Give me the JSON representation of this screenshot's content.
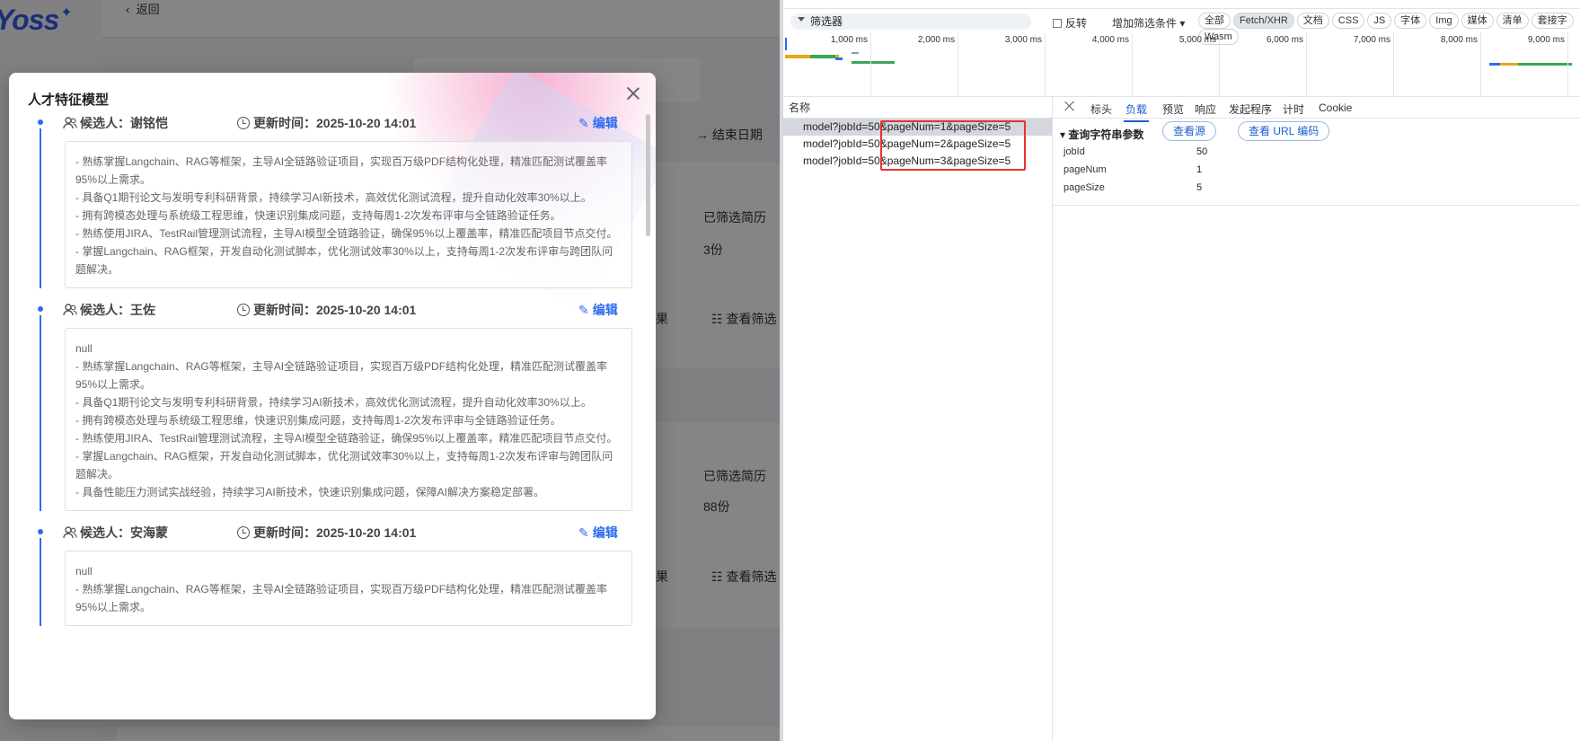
{
  "page": {
    "back_label": "返回",
    "end_date_label": "→ 结束日期",
    "screened_label_1": "已筛选简历",
    "screened_value_1": "3份",
    "screened_label_2": "已筛选简历",
    "screened_value_2": "88份",
    "result_label_1": "果",
    "view_screen_label_1": "查看筛选",
    "result_label_2": "果",
    "view_screen_label_2": "查看筛选"
  },
  "modal": {
    "title": "人才特征模型",
    "candidates": [
      {
        "name_label": "候选人：谢铭恺",
        "time_label": "更新时间：2025-10-20 14:01",
        "edit_label": "编辑",
        "lines": [
          "- 熟练掌握Langchain、RAG等框架，主导AI全链路验证项目，实现百万级PDF结构化处理，精准匹配测试覆盖率95%以上需求。",
          "- 具备Q1期刊论文与发明专利科研背景，持续学习AI新技术，高效优化测试流程，提升自动化效率30%以上。",
          "- 拥有跨模态处理与系统级工程思维，快速识别集成问题，支持每周1-2次发布评审与全链路验证任务。",
          "- 熟练使用JIRA、TestRail管理测试流程，主导AI模型全链路验证，确保95%以上覆盖率，精准匹配项目节点交付。",
          "- 掌握Langchain、RAG框架，开发自动化测试脚本，优化测试效率30%以上，支持每周1-2次发布评审与跨团队问题解决。"
        ]
      },
      {
        "name_label": "候选人：王佐",
        "time_label": "更新时间：2025-10-20 14:01",
        "edit_label": "编辑",
        "lines": [
          "null",
          "- 熟练掌握Langchain、RAG等框架，主导AI全链路验证项目，实现百万级PDF结构化处理，精准匹配测试覆盖率95%以上需求。",
          "- 具备Q1期刊论文与发明专利科研背景，持续学习AI新技术，高效优化测试流程，提升自动化效率30%以上。",
          "- 拥有跨模态处理与系统级工程思维，快速识别集成问题，支持每周1-2次发布评审与全链路验证任务。",
          "- 熟练使用JIRA、TestRail管理测试流程，主导AI模型全链路验证，确保95%以上覆盖率，精准匹配项目节点交付。",
          "- 掌握Langchain、RAG框架，开发自动化测试脚本，优化测试效率30%以上，支持每周1-2次发布评审与跨团队问题解决。",
          "- 具备性能压力测试实战经验，持续学习AI新技术，快速识别集成问题，保障AI解决方案稳定部署。"
        ]
      },
      {
        "name_label": "候选人：安海蒙",
        "time_label": "更新时间：2025-10-20 14:01",
        "edit_label": "编辑",
        "lines": [
          "null",
          "- 熟练掌握Langchain、RAG等框架，主导AI全链路验证项目，实现百万级PDF结构化处理，精准匹配测试覆盖率95%以上需求。"
        ]
      }
    ]
  },
  "devtools": {
    "filter_placeholder": "筛选器",
    "invert_label": "反转",
    "more_filters_label": "增加筛选条件 ▾",
    "chips": [
      "全部",
      "Fetch/XHR",
      "文档",
      "CSS",
      "JS",
      "字体",
      "Img",
      "媒体",
      "清单",
      "套接字",
      "Wasm"
    ],
    "active_chip": "Fetch/XHR",
    "timeline_ticks": [
      "1,000 ms",
      "2,000 ms",
      "3,000 ms",
      "4,000 ms",
      "5,000 ms",
      "6,000 ms",
      "7,000 ms",
      "8,000 ms",
      "9,000 ms"
    ],
    "names_header": "名称",
    "requests": [
      "model?jobId=50&pageNum=1&pageSize=5",
      "model?jobId=50&pageNum=2&pageSize=5",
      "model?jobId=50&pageNum=3&pageSize=5"
    ],
    "tabs": [
      "标头",
      "负载",
      "预览",
      "响应",
      "发起程序",
      "计时",
      "Cookie"
    ],
    "active_tab": "负载",
    "query_title": "▾ 查询字符串参数",
    "view_source_label": "查看源",
    "view_url_encoded_label": "查看 URL 编码",
    "params": [
      {
        "key": "jobId",
        "value": "50"
      },
      {
        "key": "pageNum",
        "value": "1"
      },
      {
        "key": "pageSize",
        "value": "5"
      }
    ],
    "accent_color": "#1a5fd0",
    "highlight_color": "#e83131"
  }
}
